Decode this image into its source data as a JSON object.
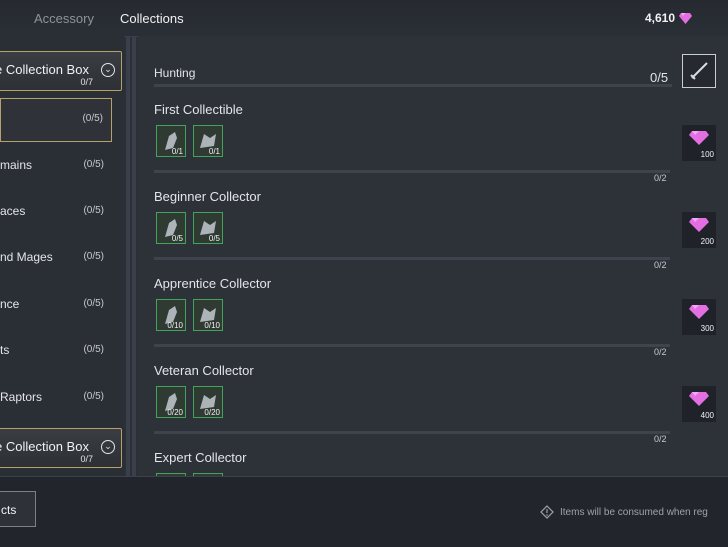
{
  "tabs": [
    {
      "label": "Accessory",
      "active": false
    },
    {
      "label": "Collections",
      "active": true
    }
  ],
  "currency": {
    "amount": "4,610",
    "icon": "gem-icon",
    "color": "#e36fe3"
  },
  "sidebar": {
    "boxes": [
      {
        "title": "e Collection Box",
        "count": "0/7"
      },
      {
        "title": "e Collection Box",
        "count": "0/7"
      }
    ],
    "items": [
      {
        "label": "",
        "count": "(0/5)"
      },
      {
        "label": "mains",
        "count": "(0/5)"
      },
      {
        "label": "aces",
        "count": "(0/5)"
      },
      {
        "label": "nd Mages",
        "count": "(0/5)"
      },
      {
        "label": "nce",
        "count": "(0/5)"
      },
      {
        "label": "ts",
        "count": "(0/5)"
      },
      {
        "label": "Raptors",
        "count": "(0/5)"
      }
    ]
  },
  "main": {
    "section": {
      "title": "Hunting",
      "count": "0/5",
      "icon": "sword-icon"
    },
    "entries": [
      {
        "name": "First Collectible",
        "slots": [
          "0/1",
          "0/1"
        ],
        "progress": "0/2",
        "reward": "100"
      },
      {
        "name": "Beginner Collector",
        "slots": [
          "0/5",
          "0/5"
        ],
        "progress": "0/2",
        "reward": "200"
      },
      {
        "name": "Apprentice Collector",
        "slots": [
          "0/10",
          "0/10"
        ],
        "progress": "0/2",
        "reward": "300"
      },
      {
        "name": "Veteran Collector",
        "slots": [
          "0/20",
          "0/20"
        ],
        "progress": "0/2",
        "reward": "400"
      },
      {
        "name": "Expert Collector",
        "slots": [
          "",
          ""
        ],
        "progress": "",
        "reward": ""
      }
    ]
  },
  "bottom": {
    "collect_label": "cts",
    "notice": "Items will be consumed when reg"
  },
  "colors": {
    "accent_gold": "#b7a16a",
    "slot_green": "#44a35a",
    "gem": "#e36fe3"
  }
}
